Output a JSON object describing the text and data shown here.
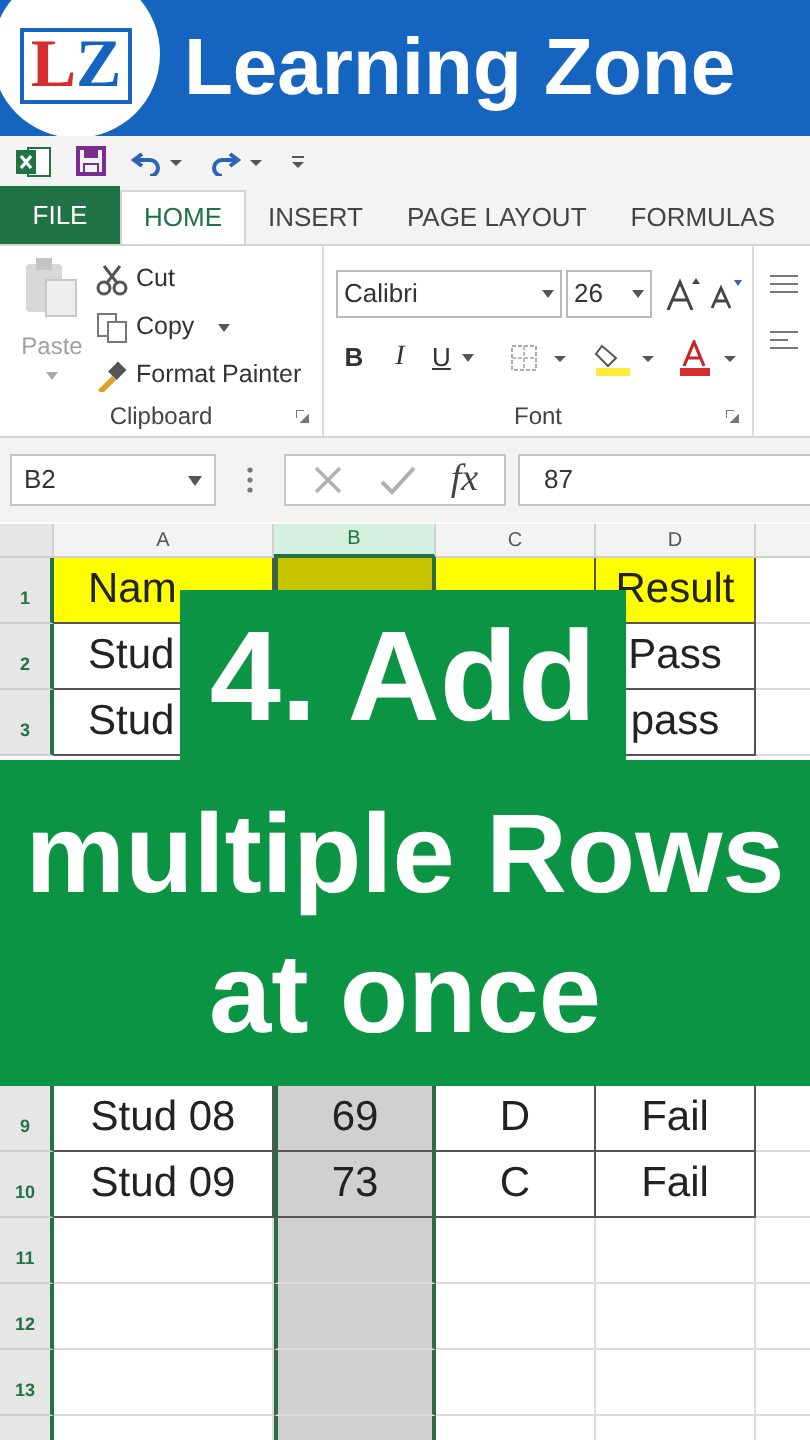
{
  "banner": {
    "logo_letters": [
      "L",
      "Z"
    ],
    "title": "Learning Zone"
  },
  "tabs": [
    {
      "label": "FILE",
      "kind": "file",
      "selected": false
    },
    {
      "label": "HOME",
      "kind": "tab",
      "selected": true
    },
    {
      "label": "INSERT",
      "kind": "tab",
      "selected": false
    },
    {
      "label": "PAGE LAYOUT",
      "kind": "tab",
      "selected": false
    },
    {
      "label": "FORMULAS",
      "kind": "tab",
      "selected": false
    }
  ],
  "clipboard": {
    "paste": {
      "label": "Paste",
      "disabled": true
    },
    "items": [
      {
        "label": "Cut",
        "kind": "cut"
      },
      {
        "label": "Copy",
        "kind": "copy"
      },
      {
        "label": "Format Painter",
        "kind": "painter"
      }
    ],
    "group_label": "Clipboard"
  },
  "font": {
    "font_name": "Calibri",
    "font_size": "26",
    "bold": "B",
    "italic": "I",
    "underline": "U",
    "group_label": "Font"
  },
  "formula_bar": {
    "name_box": "B2",
    "function_label": "fx",
    "value": "87"
  },
  "sheet": {
    "columns": [
      {
        "label": "A",
        "selected": false
      },
      {
        "label": "B",
        "selected": true
      },
      {
        "label": "C",
        "selected": false
      },
      {
        "label": "D",
        "selected": false
      }
    ],
    "rows": [
      {
        "number": "1",
        "kind": "header",
        "cells": {
          "A": "Nam",
          "D": "Result"
        }
      },
      {
        "number": "2",
        "kind": "partial",
        "cells": {
          "A": "Stud",
          "D": "Pass"
        }
      },
      {
        "number": "3",
        "kind": "partial",
        "cells": {
          "A": "Stud",
          "D": "pass"
        }
      },
      {
        "number": "9",
        "kind": "data",
        "cells": {
          "A": "Stud 08",
          "B": "69",
          "C": "D",
          "D": "Fail"
        }
      },
      {
        "number": "10",
        "kind": "data",
        "cells": {
          "A": "Stud 09",
          "B": "73",
          "C": "C",
          "D": "Fail"
        }
      },
      {
        "number": "11",
        "kind": "empty"
      },
      {
        "number": "12",
        "kind": "empty"
      },
      {
        "number": "13",
        "kind": "empty"
      }
    ]
  },
  "overlay": {
    "step": "4. Add",
    "caption_lines": [
      "multiple Rows",
      "at once"
    ]
  }
}
